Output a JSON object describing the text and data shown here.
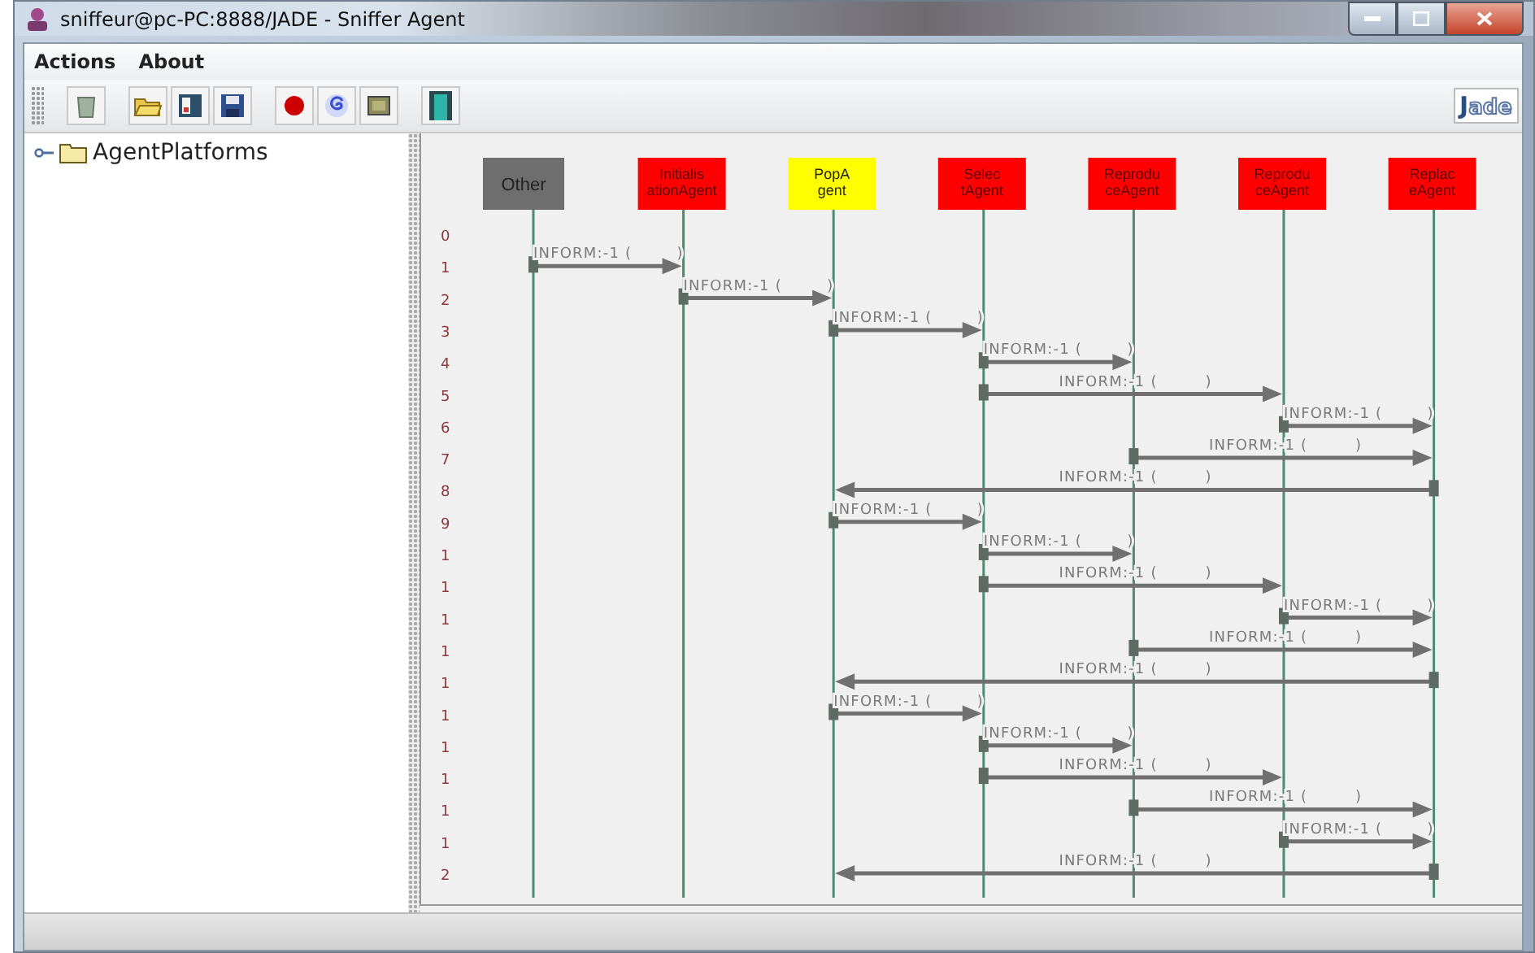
{
  "window": {
    "title": "sniffeur@pc-PC:8888/JADE - Sniffer Agent"
  },
  "menu": [
    "Actions",
    "About"
  ],
  "logo": "Jade",
  "tree": [
    {
      "label": "AgentPlatforms",
      "expanded": false
    }
  ],
  "diagram": {
    "agents": [
      {
        "lines": [
          "Other"
        ],
        "color": "#6e6e6e"
      },
      {
        "lines": [
          "Initialis",
          "ationAgent"
        ],
        "color": "#ff0000"
      },
      {
        "lines": [
          "PopA",
          "gent"
        ],
        "color": "#ffff00"
      },
      {
        "lines": [
          "Selec",
          "tAgent"
        ],
        "color": "#ff0000"
      },
      {
        "lines": [
          "Reprodu",
          "ceAgent"
        ],
        "color": "#ff0000"
      },
      {
        "lines": [
          "Reprodu",
          "ceAgent"
        ],
        "color": "#ff0000"
      },
      {
        "lines": [
          "Replac",
          "eAgent"
        ],
        "color": "#ff0000"
      }
    ],
    "rows": [
      "0",
      "1",
      "2",
      "3",
      "4",
      "5",
      "6",
      "7",
      "8",
      "9",
      "1",
      "1",
      "1",
      "1",
      "1",
      "1",
      "1",
      "1",
      "1",
      "1",
      "2"
    ],
    "messages": [
      {
        "label": "INFORM:-1 (",
        "end": ")"
      },
      {
        "label": "INFORM:-1 (",
        "end": ")"
      },
      {
        "label": "INFORM:-1 (",
        "end": ")"
      },
      {
        "label": "INFORM:-1 (",
        "end": ")"
      },
      {
        "label": "INFORM:-1 (",
        "end": ")"
      },
      {
        "label": "INFORM:-1 (",
        "end": ")"
      },
      {
        "label": "INFORM:-1 (",
        "end": ")"
      },
      {
        "label": "INFORM:-1 (",
        "end": ")"
      },
      {
        "label": "INFORM:-1 (",
        "end": ")"
      },
      {
        "label": "INFORM:-1 (",
        "end": ")"
      },
      {
        "label": "INFORM:-1 (",
        "end": ")"
      },
      {
        "label": "INFORM:-1 (",
        "end": ")"
      },
      {
        "label": "INFORM:-1 (",
        "end": ")"
      },
      {
        "label": "INFORM:-1 (",
        "end": ")"
      },
      {
        "label": "INFORM:-1 (",
        "end": ")"
      },
      {
        "label": "INFORM:-1 (",
        "end": ")"
      },
      {
        "label": "INFORM:-1 (",
        "end": ")"
      },
      {
        "label": "INFORM:-1 (",
        "end": ")"
      },
      {
        "label": "INFORM:-1 (",
        "end": ")"
      },
      {
        "label": "INFORM:-1 (",
        "end": ")"
      }
    ]
  }
}
